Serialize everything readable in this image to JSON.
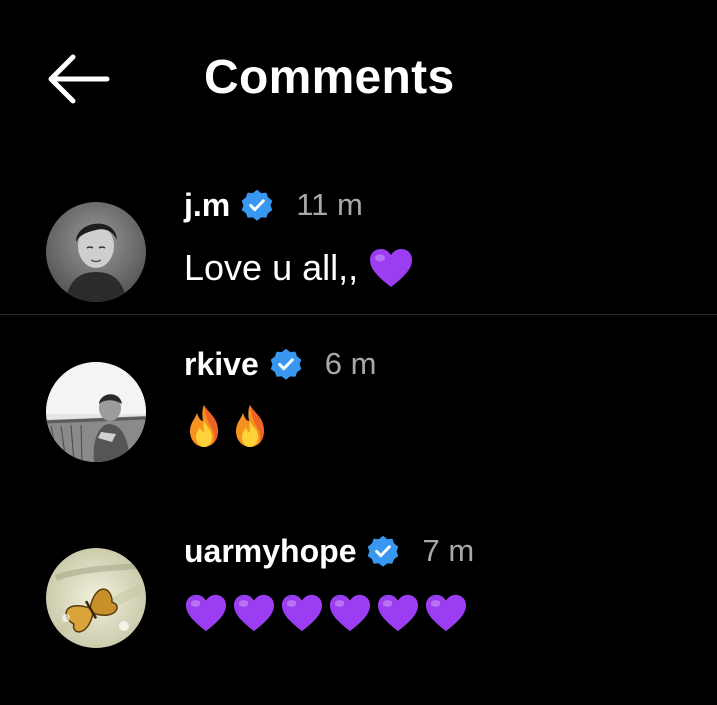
{
  "header": {
    "title": "Comments",
    "back_icon": "arrow-left-icon"
  },
  "comments": [
    {
      "username": "j.m",
      "verified": true,
      "time": "11 m",
      "text": "Love u all,,",
      "emojis": [
        "purple-heart"
      ]
    },
    {
      "username": "rkive",
      "verified": true,
      "time": "6 m",
      "text": "",
      "emojis": [
        "fire",
        "fire"
      ]
    },
    {
      "username": "uarmyhope",
      "verified": true,
      "time": "7 m",
      "text": "",
      "emojis": [
        "purple-heart",
        "purple-heart",
        "purple-heart",
        "purple-heart",
        "purple-heart",
        "purple-heart"
      ]
    }
  ],
  "colors": {
    "background": "#000000",
    "text": "#ffffff",
    "muted": "#a8a8a8",
    "verified_badge": "#3897f0",
    "heart": "#9b3df0",
    "divider": "#2a2a2a"
  }
}
